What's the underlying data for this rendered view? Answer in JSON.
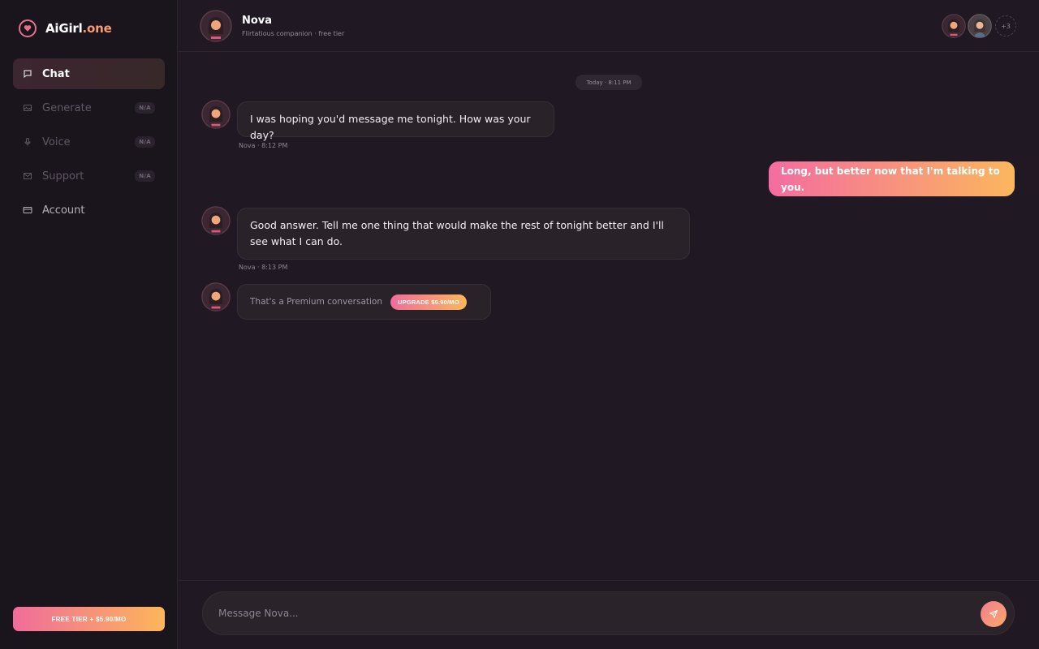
{
  "brand": {
    "name_main": "AiGirl",
    "name_tld": ".one",
    "logo_icon": "heart-icon"
  },
  "sidebar": {
    "items": [
      {
        "label": "Chat",
        "icon": "chat-icon",
        "badge": ""
      },
      {
        "label": "Generate",
        "icon": "image-icon",
        "badge": "N/A"
      },
      {
        "label": "Voice",
        "icon": "microphone-icon",
        "badge": "N/A"
      },
      {
        "label": "Support",
        "icon": "mail-icon",
        "badge": "N/A"
      },
      {
        "label": "Account",
        "icon": "card-icon",
        "badge": ""
      }
    ],
    "plan_button": "FREE TIER + $5.90/MO"
  },
  "header": {
    "name": "Nova",
    "subtitle": "Flirtatious companion · free tier",
    "more_count": "+3"
  },
  "chat": {
    "date_label": "Today · 8:11 PM",
    "messages": [
      {
        "from": "Nova",
        "text": "I was hoping you'd message me tonight. How was your day?",
        "meta": "Nova · 8:12 PM"
      },
      {
        "from": "user",
        "text": "Long, but better now that I'm talking to you."
      },
      {
        "from": "Nova",
        "text": "Good answer. Tell me one thing that would make the rest of tonight better and I'll see what I can do.",
        "meta": "Nova · 8:13 PM"
      }
    ],
    "premium": {
      "text": "That's a Premium conversation",
      "button": "UPGRADE $5.90/MO"
    }
  },
  "composer": {
    "placeholder": "Message Nova...",
    "send_icon": "send-icon"
  },
  "colors": {
    "accent_start": "#f06c9b",
    "accent_end": "#fdb65a",
    "background": "#201923",
    "sidebar": "#1a151d"
  }
}
